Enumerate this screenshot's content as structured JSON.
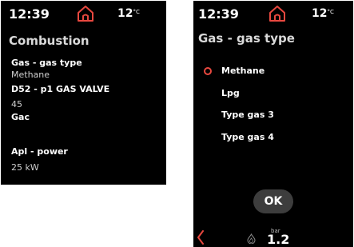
{
  "accent_color": "#e8483f",
  "left_screen": {
    "header": {
      "time": "12:39",
      "temperature": "12",
      "temperature_unit": "°C",
      "home_icon": "home-icon"
    },
    "title": "Combustion",
    "params": [
      {
        "label": "Gas - gas type",
        "value": "Methane"
      },
      {
        "label": "D52 - p1 GAS VALVE",
        "value": "45"
      },
      {
        "label": "Gac",
        "value": ""
      },
      {
        "label": "Apl - power",
        "value": "25 kW"
      }
    ]
  },
  "right_screen": {
    "header": {
      "time": "12:39",
      "temperature": "12",
      "temperature_unit": "°C",
      "home_icon": "home-icon"
    },
    "title": "Gas - gas type",
    "options": [
      {
        "label": "Methane",
        "selected": true
      },
      {
        "label": "Lpg",
        "selected": false
      },
      {
        "label": "Type gas 3",
        "selected": false
      },
      {
        "label": "Type gas 4",
        "selected": false
      }
    ],
    "ok_label": "OK",
    "bottom_bar": {
      "back_icon": "chevron-left-icon",
      "flame_icon": "flame-icon",
      "pressure_unit": "bar",
      "pressure_value": "1.2"
    }
  }
}
